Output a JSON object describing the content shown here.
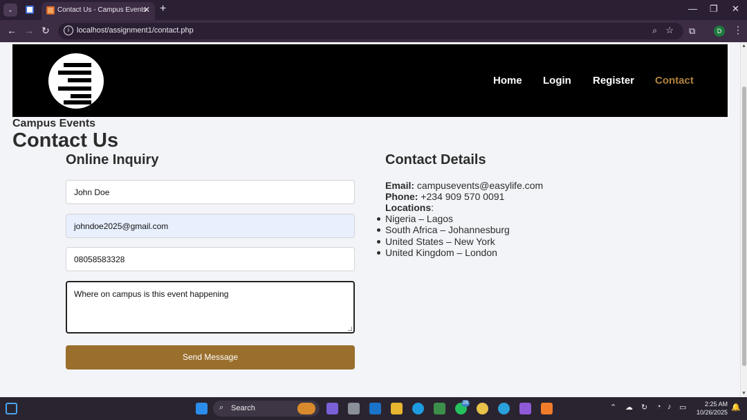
{
  "browser": {
    "tab_title": "Contact Us - Campus Events",
    "url": "localhost/assignment1/contact.php",
    "profile_initial": "D"
  },
  "site": {
    "nav": [
      "Home",
      "Login",
      "Register",
      "Contact"
    ],
    "active_nav": "Contact",
    "brand": "Campus Events",
    "page_title": "Contact Us",
    "accent_color": "#b0823d",
    "button_color": "#9a6f2c"
  },
  "form": {
    "heading": "Online Inquiry",
    "name_value": "John Doe",
    "email_value": "johndoe2025@gmail.com",
    "phone_value": "08058583328",
    "message_value": "Where on campus is this event happening",
    "submit_label": "Send Message"
  },
  "contact": {
    "heading": "Contact Details",
    "email_label": "Email:",
    "email_value": "campusevents@easylife.com",
    "phone_label": "Phone:",
    "phone_value": "+234 909 570 0091",
    "locations_label": "Locations",
    "locations": [
      "Nigeria – Lagos",
      "South Africa – Johannesburg",
      "United States – New York",
      "United Kingdom – London"
    ]
  },
  "taskbar": {
    "search_label": "Search",
    "whatsapp_badge": "28",
    "time": "2:25 AM",
    "date": "10/26/2025"
  }
}
